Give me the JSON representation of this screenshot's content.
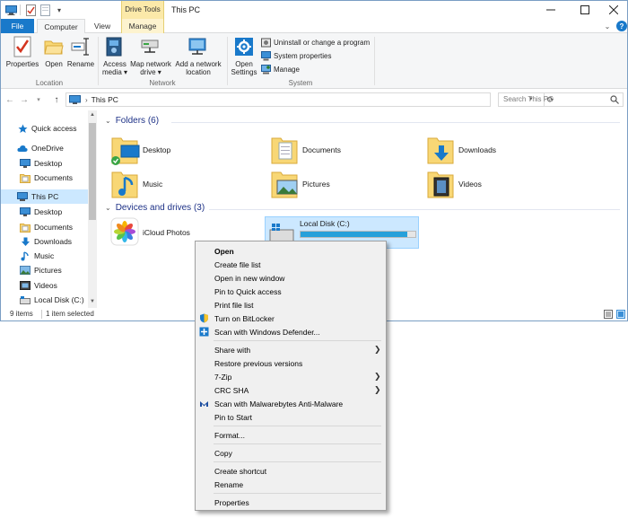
{
  "titlebar": {
    "context_tab": "Drive Tools",
    "window_title": "This PC"
  },
  "tabs": {
    "file": "File",
    "computer": "Computer",
    "view": "View",
    "manage": "Manage"
  },
  "ribbon": {
    "properties": "Properties",
    "open": "Open",
    "rename": "Rename",
    "access_media_1": "Access",
    "access_media_2": "media ▾",
    "map_drive_1": "Map network",
    "map_drive_2": "drive ▾",
    "add_location_1": "Add a network",
    "add_location_2": "location",
    "open_settings_1": "Open",
    "open_settings_2": "Settings",
    "uninstall": "Uninstall or change a program",
    "system_properties": "System properties",
    "manage": "Manage",
    "group_location": "Location",
    "group_network": "Network",
    "group_system": "System"
  },
  "address": {
    "path": "This PC",
    "search_placeholder": "Search This PC"
  },
  "nav": {
    "items": [
      {
        "label": "Quick access",
        "icon": "star-icon"
      },
      {
        "label": "OneDrive",
        "icon": "cloud-icon"
      },
      {
        "label": "Desktop",
        "icon": "desktop-icon"
      },
      {
        "label": "Documents",
        "icon": "documents-icon"
      },
      {
        "label": "This PC",
        "icon": "pc-icon"
      },
      {
        "label": "Desktop",
        "icon": "desktop-icon"
      },
      {
        "label": "Documents",
        "icon": "documents-icon"
      },
      {
        "label": "Downloads",
        "icon": "downloads-icon"
      },
      {
        "label": "Music",
        "icon": "music-icon"
      },
      {
        "label": "Pictures",
        "icon": "pictures-icon"
      },
      {
        "label": "Videos",
        "icon": "videos-icon"
      },
      {
        "label": "Local Disk (C:)",
        "icon": "drive-icon"
      }
    ]
  },
  "content": {
    "folders_header": "Folders (6)",
    "devices_header": "Devices and drives (3)",
    "folders": [
      {
        "label": "Desktop"
      },
      {
        "label": "Documents"
      },
      {
        "label": "Downloads"
      },
      {
        "label": "Music"
      },
      {
        "label": "Pictures"
      },
      {
        "label": "Videos"
      }
    ],
    "icloud": "iCloud Photos",
    "drive_name": "Local Disk (C:)",
    "drive_used_fraction": 0.93
  },
  "status": {
    "items": "9 items",
    "selected": "1 item selected"
  },
  "context_menu": {
    "items": [
      {
        "label": "Open",
        "bold": true
      },
      {
        "label": "Create file list"
      },
      {
        "label": "Open in new window"
      },
      {
        "label": "Pin to Quick access"
      },
      {
        "label": "Print file list"
      },
      {
        "label": "Turn on BitLocker",
        "icon": "shield-icon"
      },
      {
        "label": "Scan with Windows Defender...",
        "icon": "defender-icon"
      },
      {
        "label": "Share with",
        "submenu": true
      },
      {
        "label": "Restore previous versions"
      },
      {
        "label": "7-Zip",
        "submenu": true
      },
      {
        "label": "CRC SHA",
        "submenu": true
      },
      {
        "label": "Scan with Malwarebytes Anti-Malware",
        "icon": "malwarebytes-icon"
      },
      {
        "label": "Pin to Start"
      },
      {
        "label": "Format..."
      },
      {
        "label": "Copy"
      },
      {
        "label": "Create shortcut"
      },
      {
        "label": "Rename"
      },
      {
        "label": "Properties"
      }
    ],
    "arrow_glyph": "❯"
  },
  "colors": {
    "accent": "#1979ca",
    "selection": "#cce8ff",
    "drive_fill": "#26a0da",
    "folder": "#f8d775",
    "context_tab": "#fbe9a9"
  }
}
